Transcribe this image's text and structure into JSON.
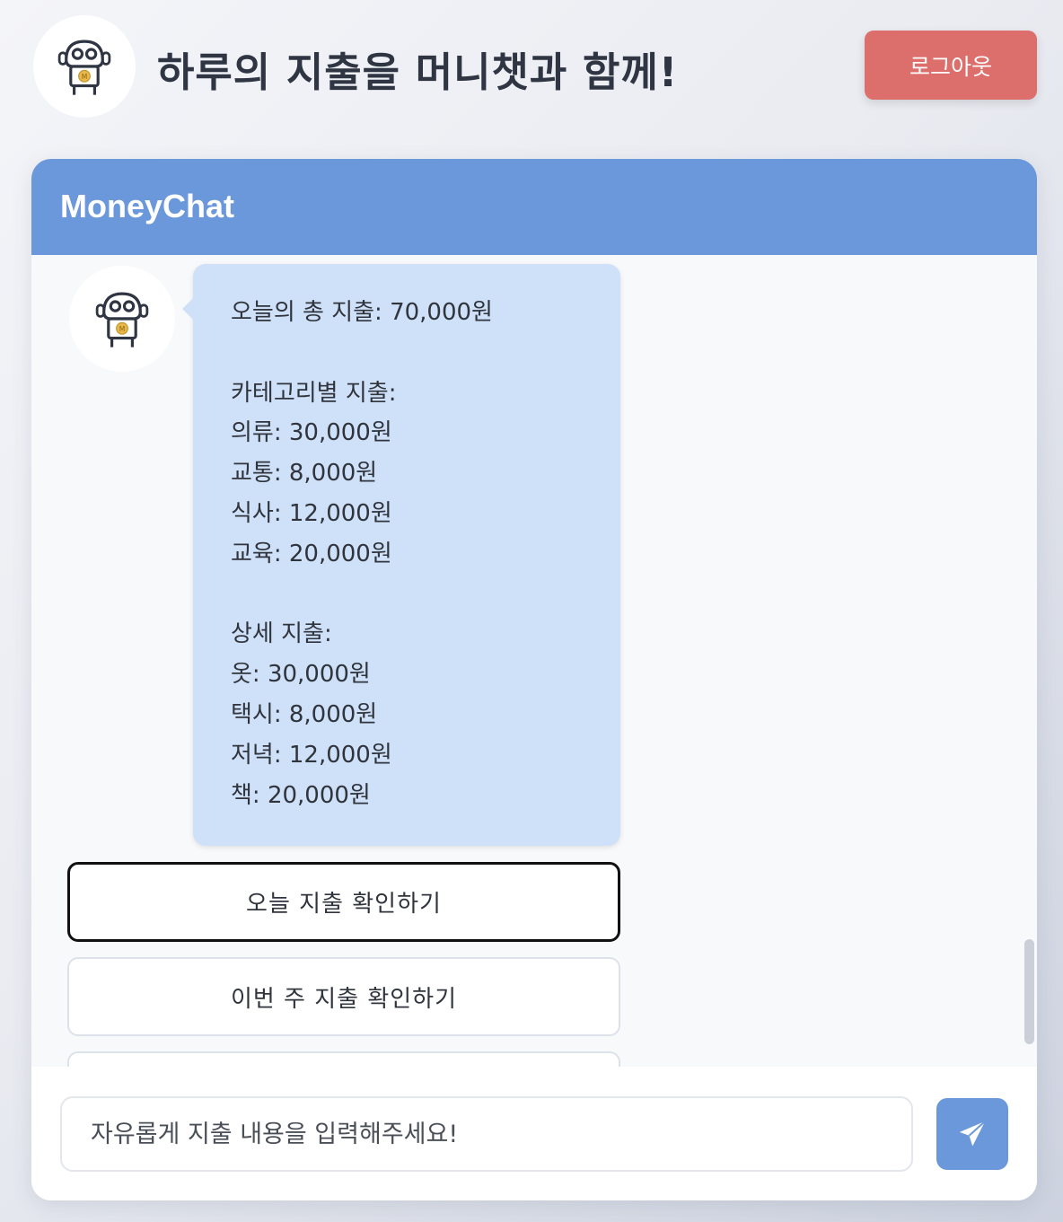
{
  "header": {
    "title": "하루의 지출을 머니챗과 함께!",
    "logout_label": "로그아웃",
    "logo_icon": "robot-icon"
  },
  "chat": {
    "title": "MoneyChat",
    "bot_avatar_icon": "robot-icon",
    "bot_message_lines": [
      "오늘의 총 지출: 70,000원",
      "",
      "카테고리별 지출:",
      "의류: 30,000원",
      "교통: 8,000원",
      "식사: 12,000원",
      "교육: 20,000원",
      "",
      "상세 지출:",
      "옷: 30,000원",
      "택시: 8,000원",
      "저녁: 12,000원",
      "책: 20,000원"
    ],
    "quick_replies": [
      {
        "label": "오늘 지출 확인하기",
        "selected": true
      },
      {
        "label": "이번 주 지출 확인하기",
        "selected": false
      },
      {
        "label": "",
        "selected": false
      }
    ]
  },
  "input": {
    "placeholder": "자유롭게 지출 내용을 입력해주세요!",
    "value": "",
    "send_icon": "paper-plane-icon"
  },
  "colors": {
    "accent": "#6b98da",
    "logout": "#dc6e6b",
    "bubble": "#cfe1f9",
    "coin": "#e8b94a"
  }
}
